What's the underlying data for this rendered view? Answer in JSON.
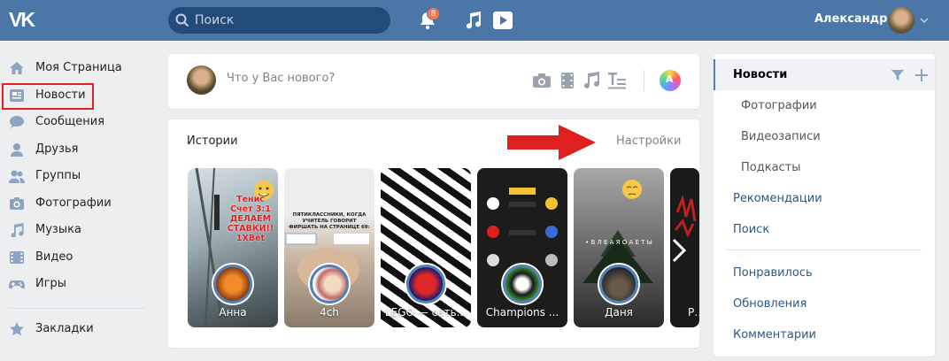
{
  "header": {
    "search_placeholder": "Поиск",
    "notifications_count": "8",
    "user_name": "Александр"
  },
  "leftnav": {
    "items": [
      {
        "label": "Моя Страница",
        "icon": "home-icon"
      },
      {
        "label": "Новости",
        "icon": "news-icon",
        "active": true
      },
      {
        "label": "Сообщения",
        "icon": "messages-icon"
      },
      {
        "label": "Друзья",
        "icon": "friends-icon"
      },
      {
        "label": "Группы",
        "icon": "groups-icon"
      },
      {
        "label": "Фотографии",
        "icon": "camera-icon"
      },
      {
        "label": "Музыка",
        "icon": "music-icon"
      },
      {
        "label": "Видео",
        "icon": "video-icon"
      },
      {
        "label": "Игры",
        "icon": "gamepad-icon"
      }
    ],
    "bookmarks_label": "Закладки"
  },
  "postbox": {
    "placeholder": "Что у Вас нового?"
  },
  "stories": {
    "title": "Истории",
    "settings_label": "Настройки",
    "items": [
      {
        "name": "Анна",
        "overlay": "Тенис\nСчет 3:1\nДЕЛАЕМ\nСТАВКИ!!\n1XBet"
      },
      {
        "name": "4ch",
        "overlay": "ПЯТИКЛАССНИКИ, КОГДА УЧИТЕЛЬ ГОВОРИТ ФИРШАТЬ НА СТРАНИЦЕ 69:"
      },
      {
        "name": "LEGO — сеть..."
      },
      {
        "name": "Champions ..."
      },
      {
        "name": "Даня",
        "overlay": "• В Л Е А Я   О А Е Т Ы"
      },
      {
        "name": "PO..."
      }
    ]
  },
  "rightmenu": {
    "items": [
      {
        "label": "Новости",
        "active": true
      },
      {
        "label": "Фотографии",
        "sub": true
      },
      {
        "label": "Видеозаписи",
        "sub": true
      },
      {
        "label": "Подкасты",
        "sub": true
      },
      {
        "label": "Рекомендации"
      },
      {
        "label": "Поиск"
      },
      {
        "label": "Понравилось"
      },
      {
        "label": "Обновления"
      },
      {
        "label": "Комментарии"
      }
    ]
  },
  "colors": {
    "header": "#4a76a8",
    "accent": "#5181b8",
    "highlight_red": "#e02020",
    "badge": "#ff734c"
  }
}
